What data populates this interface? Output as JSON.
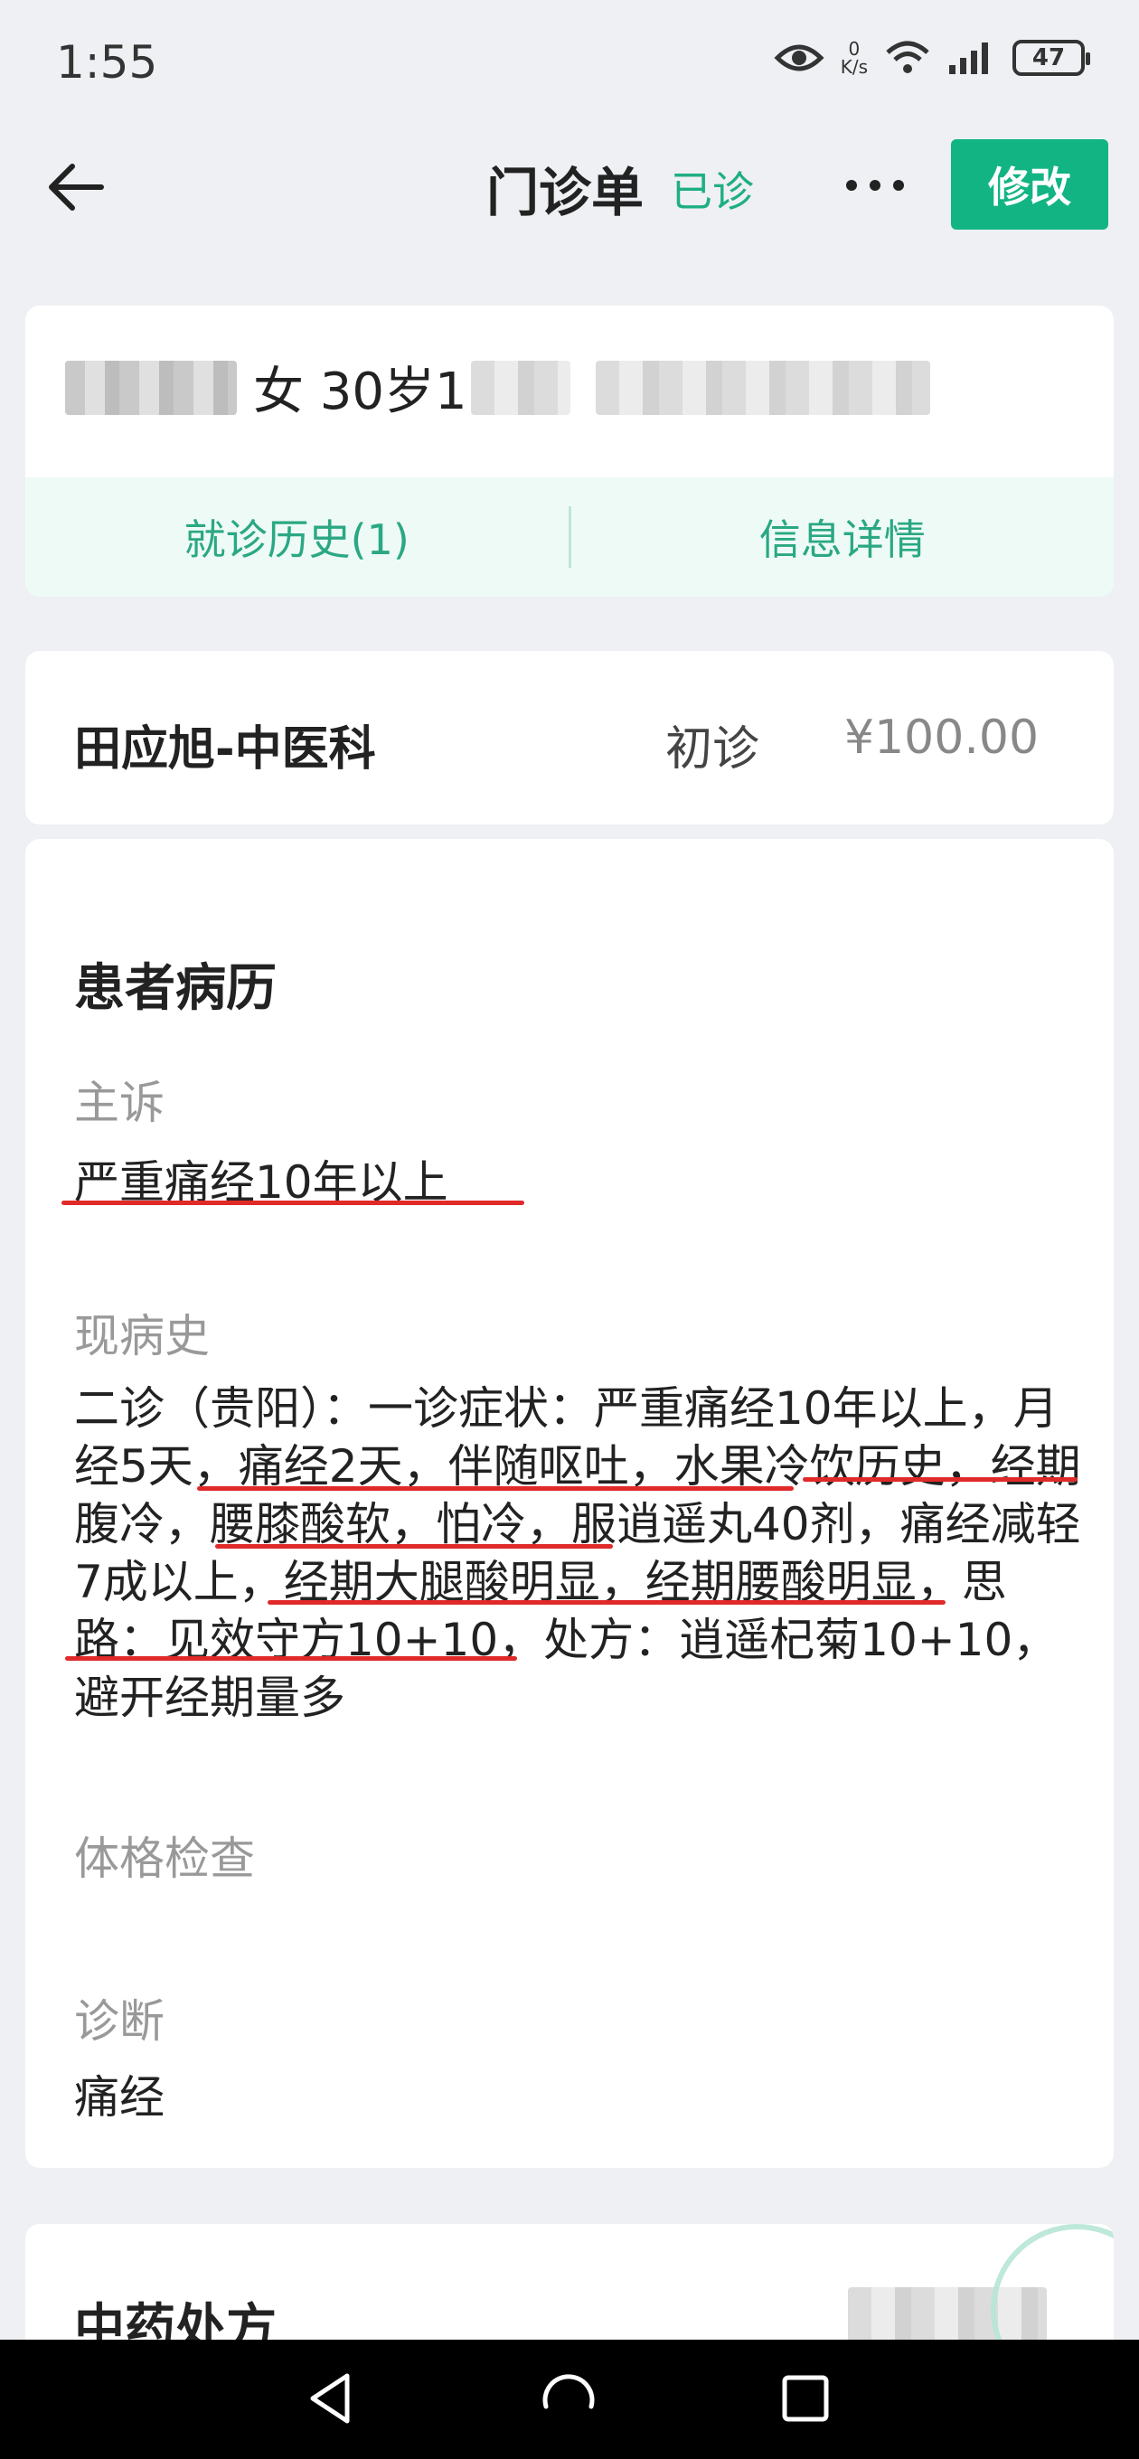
{
  "status_bar": {
    "time": "1:55",
    "net_speed_value": "0",
    "net_speed_unit": "K/s",
    "battery": "47"
  },
  "header": {
    "title": "门诊单",
    "status": "已诊",
    "edit_label": "修改"
  },
  "patient": {
    "gender_age": "女  30岁1",
    "tabs": [
      "就诊历史(1)",
      "信息详情"
    ]
  },
  "visit": {
    "doctor_dept": "田应旭-中医科",
    "visit_type": "初诊",
    "fee": "¥100.00"
  },
  "record": {
    "section_title": "患者病历",
    "chief_complaint_label": "主诉",
    "chief_complaint": "严重痛经10年以上",
    "present_history_label": "现病史",
    "present_history": "二诊（贵阳）：一诊症状：严重痛经10年以上，月经5天，痛经2天，伴随呕吐，水果冷饮历史，经期腹冷，腰膝酸软，怕冷，服逍遥丸40剂，痛经减轻7成以上，经期大腿酸明显，经期腰酸明显，思路：见效守方10+10，处方：逍遥杞菊10+10，避开经期量多",
    "exam_label": "体格检查",
    "diagnosis_label": "诊断",
    "diagnosis": "痛经"
  },
  "herbal": {
    "section_title": "中药处方"
  },
  "colors": {
    "accent": "#12b484",
    "status_green": "#1fae84",
    "tab_bg": "#eefaf6",
    "underline_red": "#e02a2a"
  },
  "icons": [
    "back-arrow-icon",
    "more-dots-icon",
    "eye-icon",
    "wifi-icon",
    "signal-icon",
    "battery-icon",
    "nav-back-icon",
    "nav-home-icon",
    "nav-recents-icon"
  ]
}
